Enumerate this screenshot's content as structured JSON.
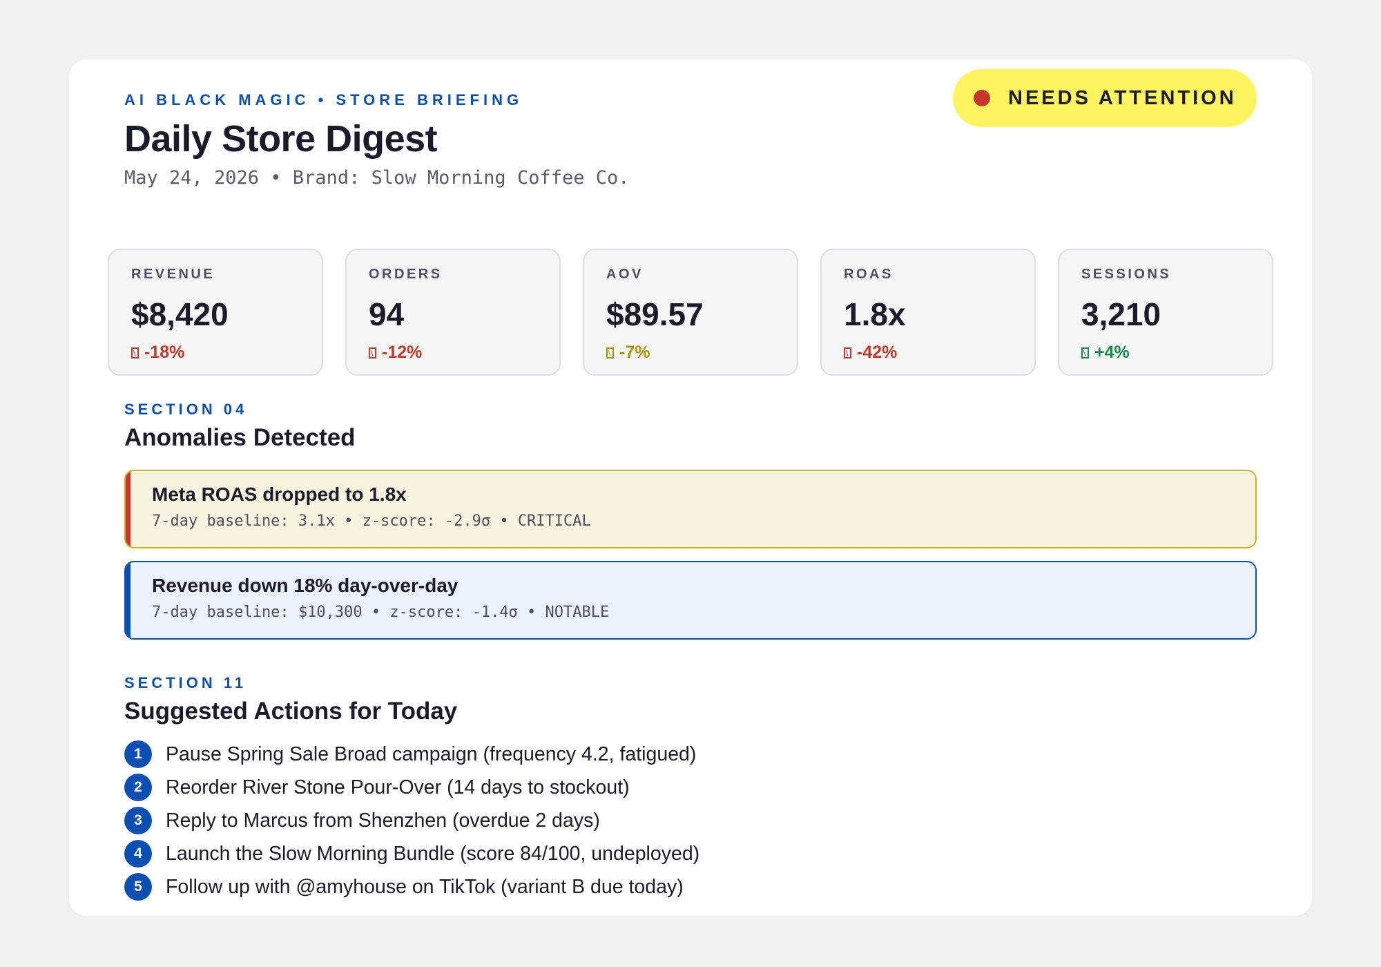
{
  "header": {
    "eyebrow": "AI BLACK MAGIC • STORE BRIEFING",
    "title": "Daily Store Digest",
    "subtitle": "May 24, 2026 • Brand: Slow Morning Coffee Co.",
    "status": {
      "label": "NEEDS ATTENTION",
      "dot_color": "#c8372d",
      "pill_color": "#fff35f"
    }
  },
  "kpis": [
    {
      "label": "REVENUE",
      "value": "$8,420",
      "delta": "-18%",
      "trend": "negative",
      "icon": "trend-icon"
    },
    {
      "label": "ORDERS",
      "value": "94",
      "delta": "-12%",
      "trend": "negative",
      "icon": "trend-icon"
    },
    {
      "label": "AOV",
      "value": "$89.57",
      "delta": "-7%",
      "trend": "warning",
      "icon": "trend-icon"
    },
    {
      "label": "ROAS",
      "value": "1.8x",
      "delta": "-42%",
      "trend": "negative",
      "icon": "trend-icon"
    },
    {
      "label": "SESSIONS",
      "value": "3,210",
      "delta": "+4%",
      "trend": "positive",
      "icon": "trend-icon"
    }
  ],
  "anomalies_section": {
    "eyebrow": "SECTION 04",
    "title": "Anomalies Detected",
    "items": [
      {
        "title": "Meta ROAS dropped to 1.8x",
        "detail": "7-day baseline: 3.1x • z-score: -2.9σ • CRITICAL",
        "severity": "critical"
      },
      {
        "title": "Revenue down 18% day-over-day",
        "detail": "7-day baseline: $10,300 • z-score: -1.4σ • NOTABLE",
        "severity": "notable"
      }
    ]
  },
  "actions_section": {
    "eyebrow": "SECTION 11",
    "title": "Suggested Actions for Today",
    "items": [
      {
        "num": "1",
        "text": "Pause Spring Sale Broad campaign (frequency 4.2, fatigued)"
      },
      {
        "num": "2",
        "text": "Reorder River Stone Pour-Over (14 days to stockout)"
      },
      {
        "num": "3",
        "text": "Reply to Marcus from Shenzhen (overdue 2 days)"
      },
      {
        "num": "4",
        "text": "Launch the Slow Morning Bundle (score 84/100, undeployed)"
      },
      {
        "num": "5",
        "text": "Follow up with @amyhouse on TikTok (variant B due today)"
      }
    ]
  },
  "colors": {
    "accent": "#0b4fb3",
    "negative": "#c0392b",
    "warning": "#a8930d",
    "positive": "#1a8a4a"
  }
}
